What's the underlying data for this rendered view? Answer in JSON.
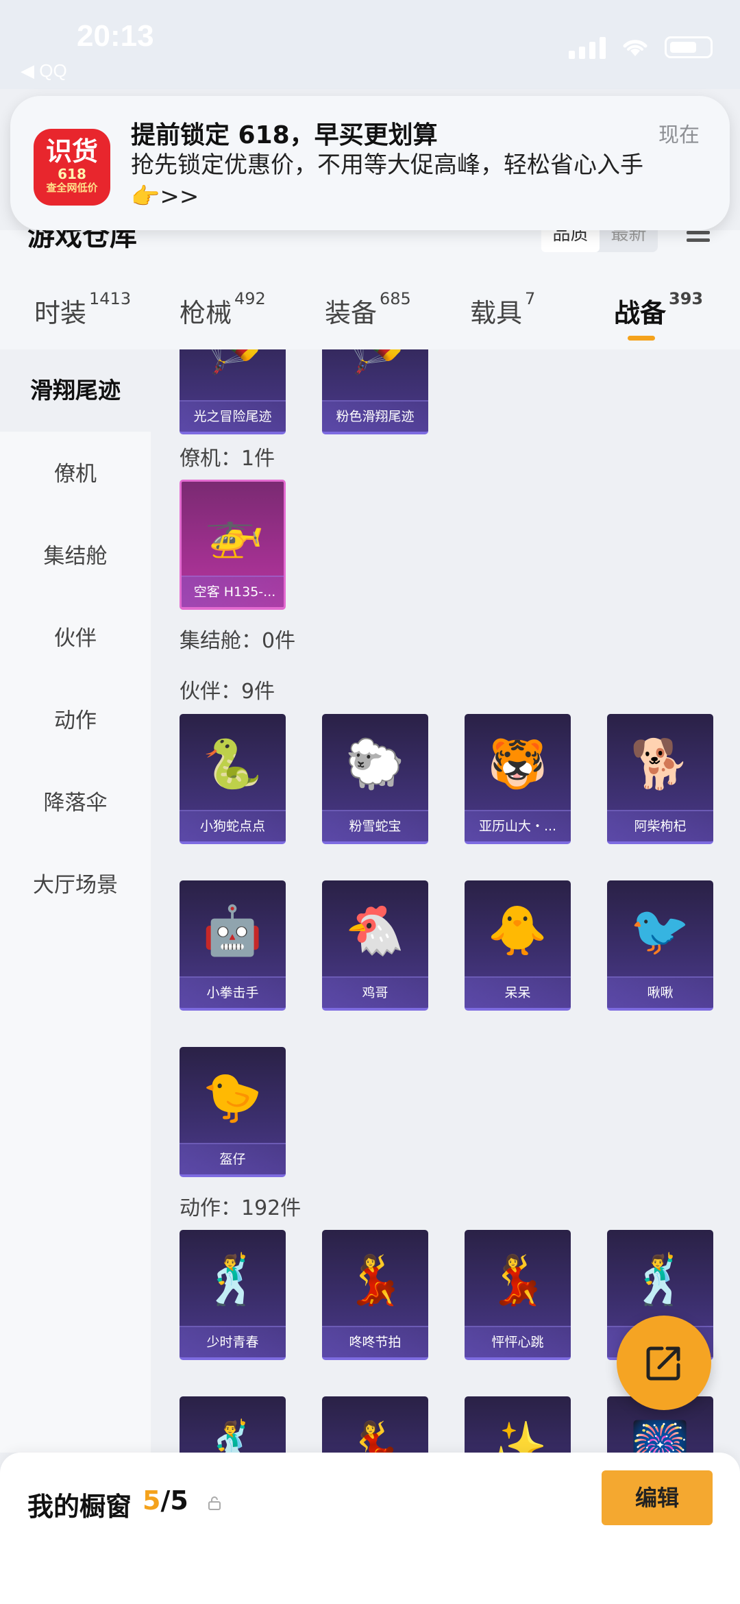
{
  "status_bar": {
    "time": "20:13",
    "back_app": "◀ QQ"
  },
  "notification": {
    "app_icon": {
      "main": "识货",
      "badge": "618",
      "sub": "查全网低价"
    },
    "title": "提前锁定 618，早买更划算",
    "time": "现在",
    "body": "抢先锁定优惠价，不用等大促高峰，轻松省心入手👉>>"
  },
  "header": {
    "title": "游戏仓库",
    "sort": [
      "品质",
      "最新"
    ],
    "sort_selected": "品质"
  },
  "tabs": [
    {
      "label": "时装",
      "count": "1413"
    },
    {
      "label": "枪械",
      "count": "492"
    },
    {
      "label": "装备",
      "count": "685"
    },
    {
      "label": "载具",
      "count": "7"
    },
    {
      "label": "战备",
      "count": "393",
      "active": true
    }
  ],
  "sidebar": [
    "滑翔尾迹",
    "僚机",
    "集结舱",
    "伙伴",
    "动作",
    "降落伞",
    "大厅场景"
  ],
  "sections": {
    "trail": {
      "items": [
        "光之冒险尾迹",
        "粉色滑翔尾迹"
      ]
    },
    "wingman": {
      "label": "僚机：1件",
      "items": [
        "空客 H135-..."
      ]
    },
    "capsule": {
      "label": "集结舱：0件"
    },
    "partner": {
      "label": "伙伴：9件",
      "items": [
        "小狗蛇点点",
        "粉雪蛇宝",
        "亚历山大・...",
        "阿柴枸杞",
        "小拳击手",
        "鸡哥",
        "呆呆",
        "啾啾",
        "盔仔"
      ]
    },
    "action": {
      "label": "动作：192件",
      "items": [
        "少时青春",
        "咚咚节拍",
        "怦怦心跳",
        ""
      ]
    }
  },
  "bottom": {
    "label": "我的橱窗",
    "count_current": "5",
    "count_total": "/5",
    "edit_label": "编辑"
  },
  "colors": {
    "accent": "#f4a21c",
    "card_purple": "#3c2f6e",
    "card_pink": "#a0308f"
  },
  "icons": {
    "share": "share-icon",
    "lock": "lock-icon"
  }
}
